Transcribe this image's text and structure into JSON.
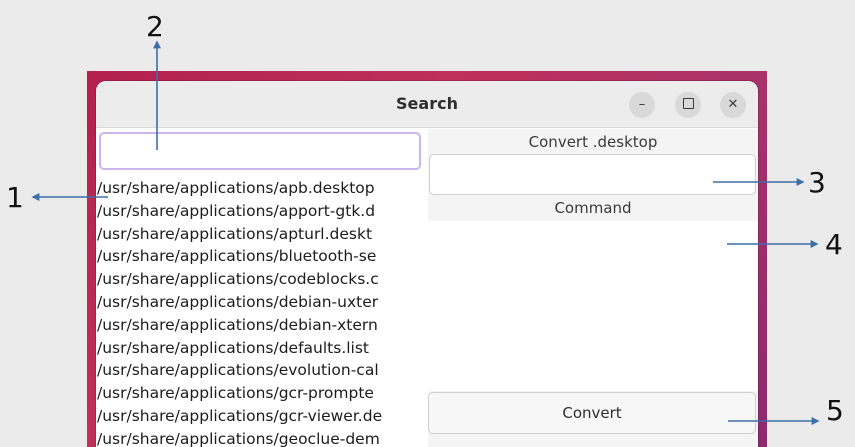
{
  "window": {
    "title": "Search",
    "controls": {
      "minimize": "–",
      "close": "✕"
    }
  },
  "search": {
    "value": "",
    "placeholder": ""
  },
  "file_list": [
    "/usr/share/applications/apb.desktop",
    "/usr/share/applications/apport-gtk.d",
    "/usr/share/applications/apturl.deskt",
    "/usr/share/applications/bluetooth-se",
    "/usr/share/applications/codeblocks.c",
    "/usr/share/applications/debian-uxter",
    "/usr/share/applications/debian-xtern",
    "/usr/share/applications/defaults.list",
    "/usr/share/applications/evolution-cal",
    "/usr/share/applications/gcr-prompte",
    "/usr/share/applications/gcr-viewer.de",
    "/usr/share/applications/geoclue-dem"
  ],
  "right_pane": {
    "convert_label": "Convert .desktop",
    "convert_value": "",
    "command_label": "Command",
    "command_value": "",
    "convert_button": "Convert"
  },
  "annotations": [
    "1",
    "2",
    "3",
    "4",
    "5"
  ],
  "colors": {
    "desktop_gradient_start": "#b3204f",
    "desktop_gradient_end": "#8c2a6e",
    "focus_border": "#c9b6ea",
    "arrow": "#3d6ea8"
  }
}
